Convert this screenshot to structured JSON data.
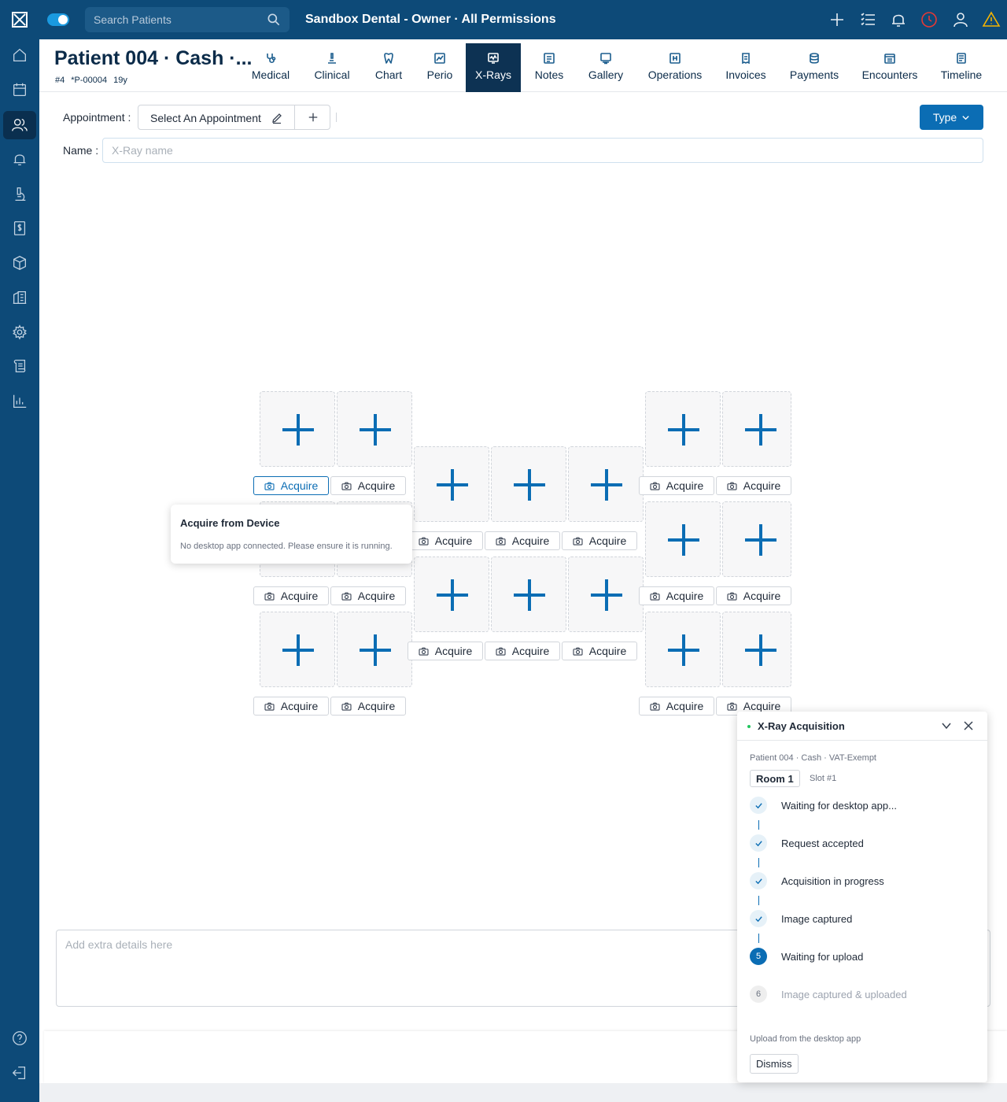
{
  "topbar": {
    "search_placeholder": "Search Patients",
    "clinic_title": "Sandbox Dental - Owner · All Permissions",
    "icons": [
      "plus-icon",
      "list-icon",
      "bell-icon",
      "clock-icon",
      "user-icon",
      "warning-icon"
    ]
  },
  "sidebar": {
    "items": [
      "home-icon",
      "calendar-icon",
      "patients-icon",
      "bell-icon",
      "microscope-icon",
      "dollar-icon",
      "box-icon",
      "building-icon",
      "gear-icon",
      "scroll-icon",
      "chart-icon"
    ],
    "active_index": 2,
    "footer_icons": [
      "help-icon",
      "logout-icon"
    ]
  },
  "patient": {
    "name": "Patient 004 · Cash ·...",
    "number": "#4",
    "code": "*P-00004",
    "age": "19y"
  },
  "tabs": [
    {
      "label": "Medical"
    },
    {
      "label": "Clinical"
    },
    {
      "label": "Chart"
    },
    {
      "label": "Perio"
    },
    {
      "label": "X-Rays"
    },
    {
      "label": "Notes"
    },
    {
      "label": "Gallery"
    },
    {
      "label": "Operations"
    },
    {
      "label": "Invoices"
    },
    {
      "label": "Payments"
    },
    {
      "label": "Encounters"
    },
    {
      "label": "Timeline"
    }
  ],
  "active_tab": "X-Rays",
  "form": {
    "appointment_label": "Appointment :",
    "appointment_value": "Select An Appointment",
    "type_button": "Type",
    "name_label": "Name :",
    "name_placeholder": "X-Ray name",
    "notes_placeholder": "Add extra details here"
  },
  "template": {
    "acquire_label": "Acquire",
    "slot_count": 18
  },
  "tooltip": {
    "title": "Acquire from Device",
    "body": "No desktop app connected. Please ensure it is running."
  },
  "acquisition_panel": {
    "title": "X-Ray Acquisition",
    "patient": "Patient 004 · Cash · VAT-Exempt",
    "room": "Room 1",
    "slot": "Slot #1",
    "steps": [
      {
        "label": "Waiting for desktop app...",
        "status": "done"
      },
      {
        "label": "Request accepted",
        "status": "done"
      },
      {
        "label": "Acquisition in progress",
        "status": "done"
      },
      {
        "label": "Image captured",
        "status": "done"
      },
      {
        "label": "Waiting for upload",
        "status": "current",
        "number": "5"
      },
      {
        "label": "Image captured & uploaded",
        "status": "pending",
        "number": "6"
      }
    ],
    "upload_note": "Upload from the desktop app",
    "dismiss_label": "Dismiss"
  },
  "colors": {
    "brand_dark": "#0d4a78",
    "accent": "#0b6db4",
    "active_tab_bg": "#0d3253",
    "warning": "#f5b400",
    "alert": "#e53935"
  }
}
